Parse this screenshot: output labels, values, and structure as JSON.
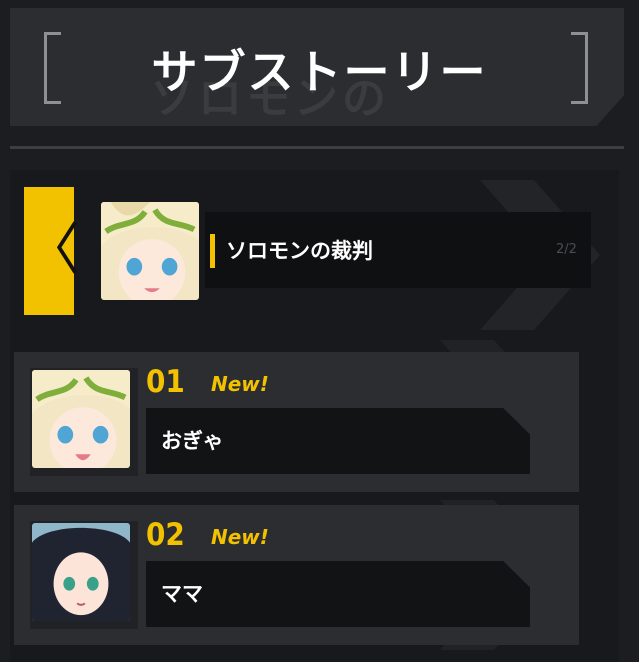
{
  "header": {
    "title": "サブストーリー",
    "title_ghost": "ソロモンの"
  },
  "selected_story": {
    "back_icon": "chevron-left-icon",
    "title": "ソロモンの裁判",
    "count": "2/2",
    "avatar": "laurel-girl-avatar"
  },
  "episodes": [
    {
      "number": "01",
      "badge": "New!",
      "title": "おぎゃ",
      "avatar": "laurel-girl-avatar"
    },
    {
      "number": "02",
      "badge": "New!",
      "title": "ママ",
      "avatar": "dark-hair-girl-avatar"
    }
  ],
  "colors": {
    "accent": "#f2c200",
    "panel": "#2b2d31",
    "background": "#1b1d20",
    "text": "#ffffff"
  }
}
